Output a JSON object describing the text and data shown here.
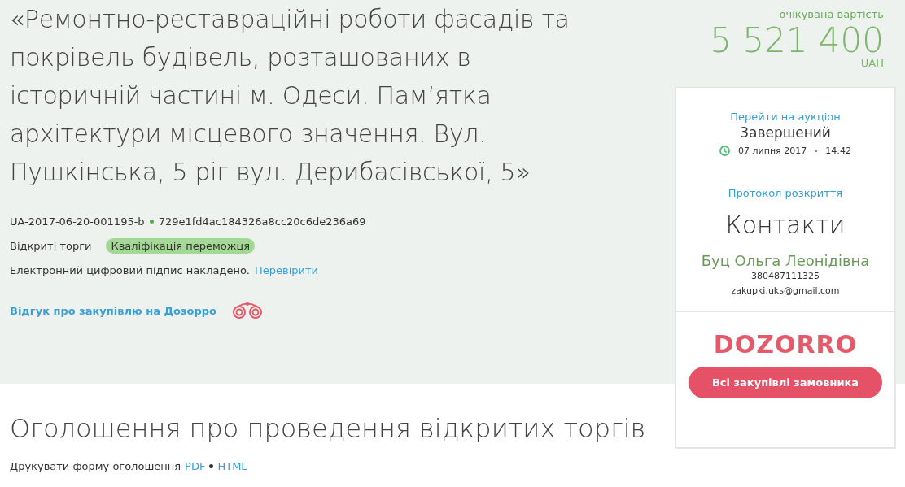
{
  "title": "«Ремонтно-реставраційні роботи фасадів та покрівель будівель, розташованих в історичній частині м. Одеси. Пам’ятка архітектури місцевого значення. Вул. Пушкінська, 5 ріг вул. Дерибасівської, 5»",
  "tender_id": "UA-2017-06-20-001195-b",
  "hash": "729e1fd4ac184326a8cc20c6de236a69",
  "procedure": "Відкриті торги",
  "status_badge": "Кваліфікація переможця",
  "signature": {
    "text": "Електронний цифровий підпис накладено.",
    "link": "Перевірити"
  },
  "review_link": "Відгук про закупівлю на Дозорро",
  "price": {
    "label": "очікувана вартість",
    "amount": "5 521 400",
    "currency": "UAH"
  },
  "auction": {
    "link": "Перейти на аукціон",
    "status": "Завершений",
    "date": "07 липня 2017",
    "time": "14:42"
  },
  "protocol_link": "Протокол розкриття",
  "contacts": {
    "heading": "Контакти",
    "name": "Буц Ольга Леонідівна",
    "phone": "380487111325",
    "email": "zakupki.uks@gmail.com"
  },
  "logo": "DOZORRO",
  "customer_button": "Всі закупівлі замовника",
  "notice": {
    "heading": "Оголошення про проведення відкритих торгів",
    "print_label": "Друкувати форму оголошення",
    "formats": [
      "PDF",
      "HTML"
    ]
  }
}
